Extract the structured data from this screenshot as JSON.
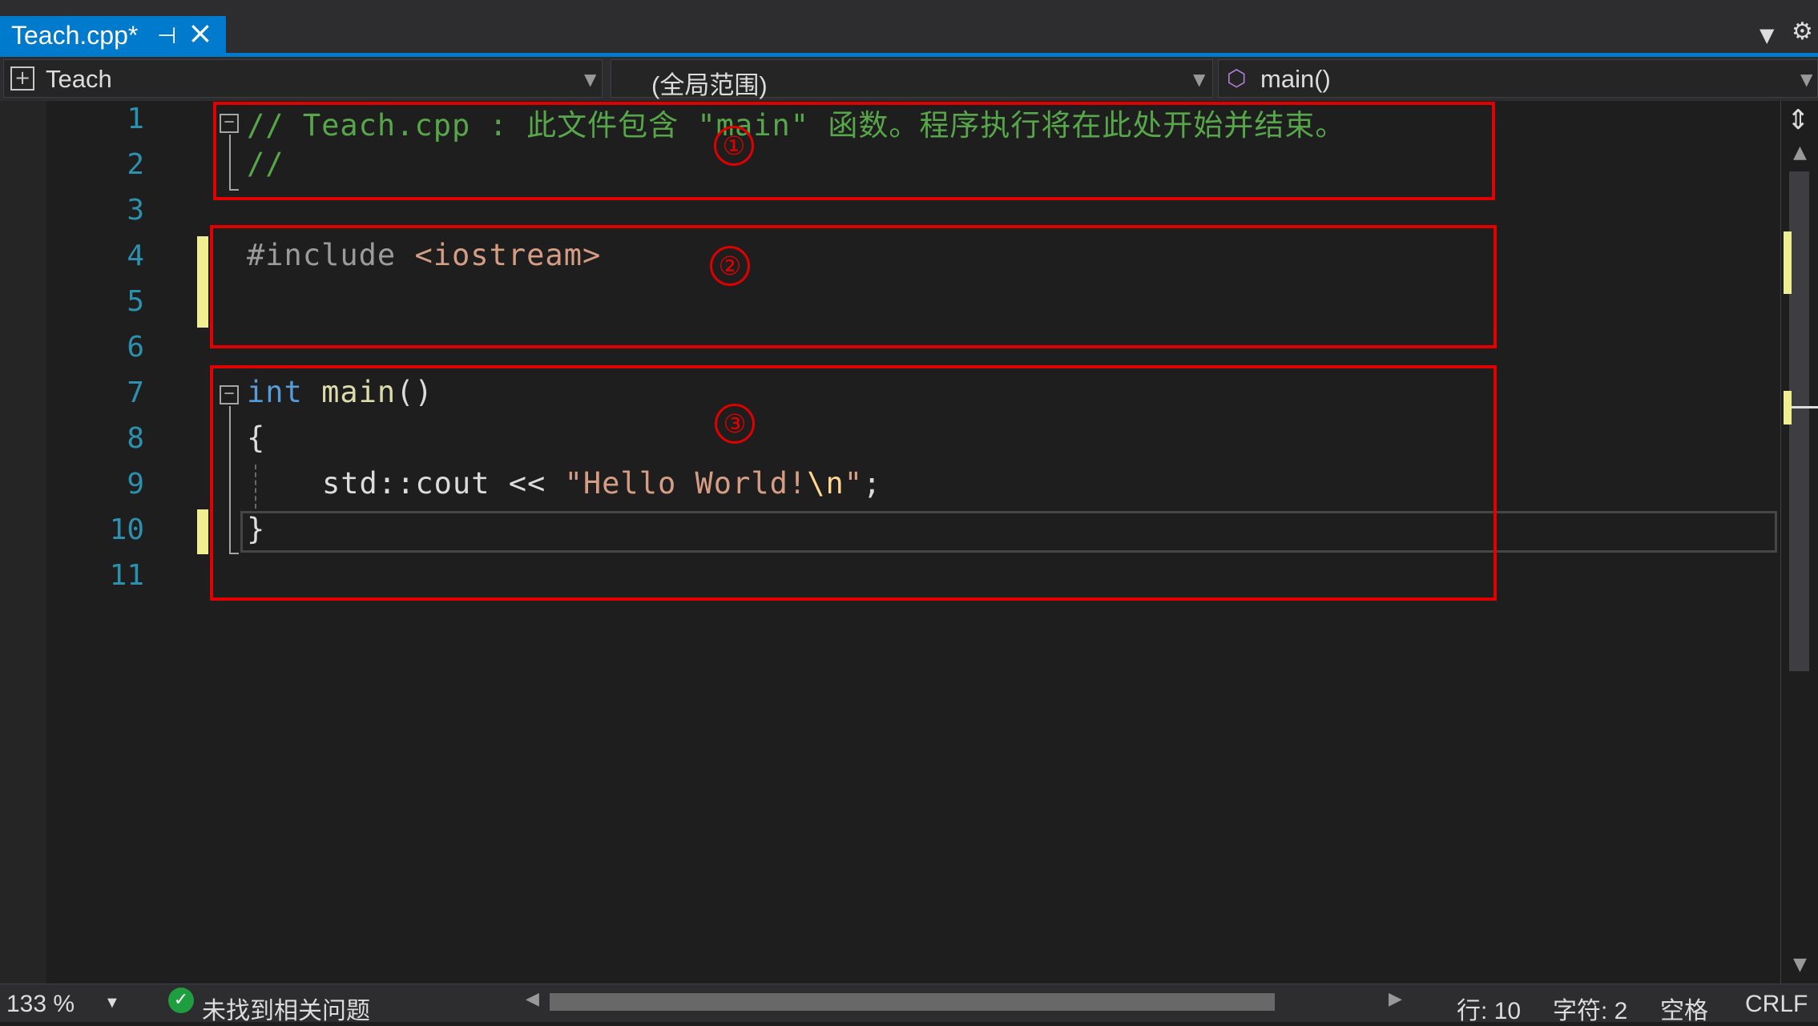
{
  "tab": {
    "title": "Teach.cpp*",
    "pin_icon": "pin-icon",
    "close_icon": "close-icon"
  },
  "navbar": {
    "project": "Teach",
    "scope": "(全局范围)",
    "member": "main()"
  },
  "editor": {
    "line_numbers": [
      "1",
      "2",
      "3",
      "4",
      "5",
      "6",
      "7",
      "8",
      "9",
      "10",
      "11"
    ],
    "lines": {
      "l1": "// Teach.cpp : 此文件包含 \"main\" 函数。程序执行将在此处开始并结束。",
      "l2": "//",
      "l4_pre": "#include ",
      "l4_inc": "<iostream>",
      "l7_kw": "int",
      "l7_fn": " main",
      "l7_rest": "()",
      "l8": "{",
      "l9_a": "std::cout << ",
      "l9_str1": "\"Hello World!",
      "l9_esc": "\\n",
      "l9_str2": "\"",
      "l9_end": ";",
      "l10": "}"
    },
    "annotations": [
      "①",
      "②",
      "③"
    ]
  },
  "statusbar": {
    "zoom": "133 %",
    "issues": "未找到相关问题",
    "line": "行: 10",
    "char": "字符: 2",
    "indent": "空格",
    "eol": "CRLF"
  },
  "colors": {
    "accent": "#007acc",
    "comment": "#57a64a",
    "keyword": "#569cd6",
    "string": "#d69d85",
    "annotation_red": "#e00000",
    "change_marker": "#efef91"
  }
}
